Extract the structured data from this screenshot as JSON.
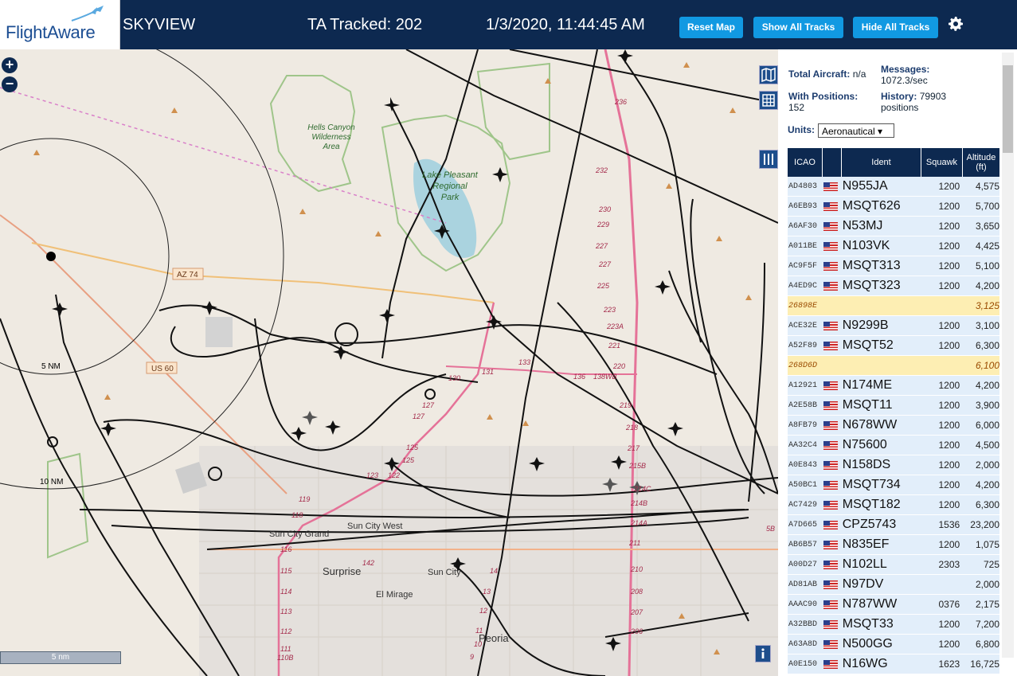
{
  "header": {
    "logo": "FlightAware",
    "brand": "SKYVIEW",
    "ta_tracked": "TA Tracked: 202",
    "datetime": "1/3/2020, 11:44:45 AM",
    "buttons": {
      "reset": "Reset Map",
      "show": "Show All Tracks",
      "hide": "Hide All Tracks"
    },
    "settings_icon": "gear-icon"
  },
  "map": {
    "zoom_in": "+",
    "zoom_out": "−",
    "scale_label": "5 nm",
    "ring_labels": [
      "5 NM",
      "10 NM"
    ],
    "places": {
      "hells_canyon": [
        "Hells Canyon",
        "Wilderness",
        "Area"
      ],
      "lake_pleasant": [
        "Lake Pleasant",
        "Regional",
        "Park"
      ],
      "sun_city_grand": "Sun City Grand",
      "sun_city_west": "Sun City West",
      "surprise": "Surprise",
      "sun_city": "Sun City",
      "el_mirage": "El Mirage",
      "peoria": "Peoria"
    },
    "shields": {
      "az74": "AZ 74",
      "us60": "US 60"
    },
    "road_numbers": [
      "236",
      "232",
      "230",
      "229",
      "227",
      "227",
      "225",
      "223",
      "223A",
      "221",
      "220",
      "219",
      "218",
      "217",
      "215B",
      "214C",
      "214B",
      "214A",
      "211",
      "210",
      "208",
      "207",
      "206",
      "131",
      "130",
      "133",
      "136",
      "138WB",
      "127",
      "127",
      "125",
      "125",
      "123",
      "122",
      "119",
      "118",
      "116",
      "115",
      "114",
      "113",
      "112",
      "111",
      "110B",
      "142",
      "14",
      "13",
      "12",
      "11",
      "10",
      "9",
      "5B"
    ]
  },
  "panel": {
    "total_aircraft_label": "Total Aircraft:",
    "total_aircraft_value": "n/a",
    "messages_label": "Messages:",
    "messages_value": "1072.3/sec",
    "with_positions_label": "With Positions:",
    "with_positions_value": "152",
    "history_label": "History:",
    "history_value": "79903",
    "history_unit": "positions",
    "units_label": "Units:",
    "units_value": "Aeronautical ▾",
    "columns": [
      "ICAO",
      "",
      "Ident",
      "Squawk",
      "Altitude (ft)"
    ],
    "rows": [
      {
        "icao": "AD4803",
        "ident": "N955JA",
        "squawk": "1200",
        "alt": "4,575",
        "hl": false
      },
      {
        "icao": "A6EB93",
        "ident": "MSQT626",
        "squawk": "1200",
        "alt": "5,700",
        "hl": false
      },
      {
        "icao": "A6AF30",
        "ident": "N53MJ",
        "squawk": "1200",
        "alt": "3,650",
        "hl": false
      },
      {
        "icao": "A011BE",
        "ident": "N103VK",
        "squawk": "1200",
        "alt": "4,425",
        "hl": false
      },
      {
        "icao": "AC9F5F",
        "ident": "MSQT313",
        "squawk": "1200",
        "alt": "5,100",
        "hl": false
      },
      {
        "icao": "A4ED9C",
        "ident": "MSQT323",
        "squawk": "1200",
        "alt": "4,200",
        "hl": false
      },
      {
        "icao": "26898E",
        "ident": "",
        "squawk": "",
        "alt": "3,125",
        "hl": true
      },
      {
        "icao": "ACE32E",
        "ident": "N9299B",
        "squawk": "1200",
        "alt": "3,100",
        "hl": false
      },
      {
        "icao": "A52F89",
        "ident": "MSQT52",
        "squawk": "1200",
        "alt": "6,300",
        "hl": false
      },
      {
        "icao": "268D6D",
        "ident": "",
        "squawk": "",
        "alt": "6,100",
        "hl": true
      },
      {
        "icao": "A12921",
        "ident": "N174ME",
        "squawk": "1200",
        "alt": "4,200",
        "hl": false
      },
      {
        "icao": "A2E58B",
        "ident": "MSQT11",
        "squawk": "1200",
        "alt": "3,900",
        "hl": false
      },
      {
        "icao": "A8FB79",
        "ident": "N678WW",
        "squawk": "1200",
        "alt": "6,000",
        "hl": false
      },
      {
        "icao": "AA32C4",
        "ident": "N75600",
        "squawk": "1200",
        "alt": "4,500",
        "hl": false
      },
      {
        "icao": "A0E843",
        "ident": "N158DS",
        "squawk": "1200",
        "alt": "2,000",
        "hl": false
      },
      {
        "icao": "A50BC1",
        "ident": "MSQT734",
        "squawk": "1200",
        "alt": "4,200",
        "hl": false
      },
      {
        "icao": "AC7429",
        "ident": "MSQT182",
        "squawk": "1200",
        "alt": "6,300",
        "hl": false
      },
      {
        "icao": "A7D665",
        "ident": "CPZ5743",
        "squawk": "1536",
        "alt": "23,200",
        "hl": false
      },
      {
        "icao": "AB6B57",
        "ident": "N835EF",
        "squawk": "1200",
        "alt": "1,075",
        "hl": false
      },
      {
        "icao": "A00D27",
        "ident": "N102LL",
        "squawk": "2303",
        "alt": "725",
        "hl": false
      },
      {
        "icao": "AD81AB",
        "ident": "N97DV",
        "squawk": "",
        "alt": "2,000",
        "hl": false
      },
      {
        "icao": "AAAC90",
        "ident": "N787WW",
        "squawk": "0376",
        "alt": "2,175",
        "hl": false
      },
      {
        "icao": "A32BBD",
        "ident": "MSQT33",
        "squawk": "1200",
        "alt": "7,200",
        "hl": false
      },
      {
        "icao": "A63A8D",
        "ident": "N500GG",
        "squawk": "1200",
        "alt": "6,800",
        "hl": false
      },
      {
        "icao": "A0E150",
        "ident": "N16WG",
        "squawk": "1623",
        "alt": "16,725",
        "hl": false
      }
    ]
  }
}
